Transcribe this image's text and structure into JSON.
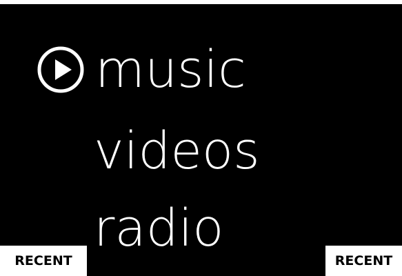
{
  "menu": {
    "items": [
      {
        "label": "music"
      },
      {
        "label": "videos"
      },
      {
        "label": "radio"
      }
    ],
    "play_icon": "play-circle-icon"
  },
  "tiles": {
    "left_label": "RECENT",
    "right_label": "RECENT"
  },
  "colors": {
    "background": "#000000",
    "text": "#ffffff",
    "tile_background": "#ffffff",
    "tile_text": "#000000"
  }
}
